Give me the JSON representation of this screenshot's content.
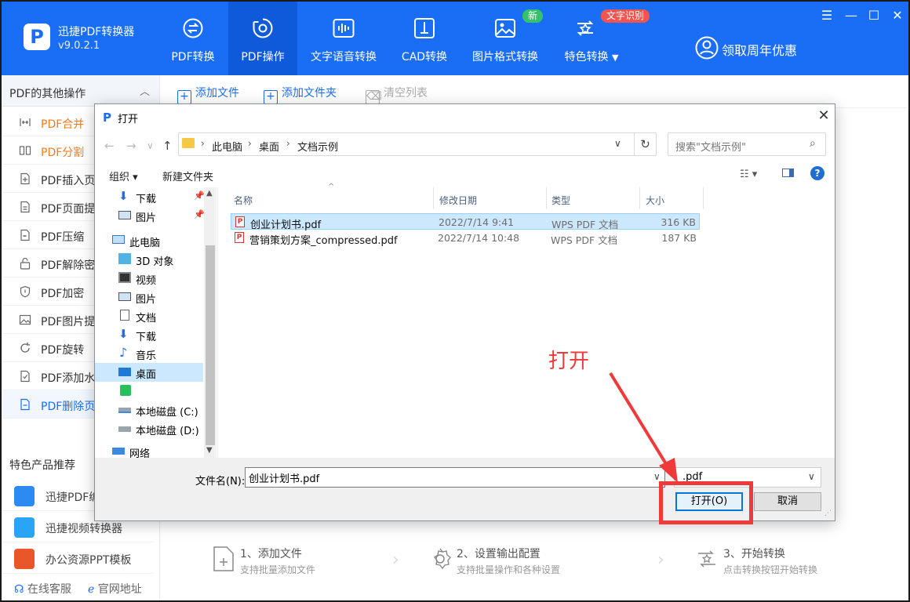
{
  "app": {
    "name": "迅捷PDF转换器",
    "version": "v9.0.2.1",
    "logo_text": "P"
  },
  "nav": [
    {
      "label": "PDF转换",
      "icon": "pdf-convert-icon"
    },
    {
      "label": "PDF操作",
      "icon": "pdf-operate-icon",
      "active": true
    },
    {
      "label": "文字语音转换",
      "icon": "voice-wave-icon"
    },
    {
      "label": "CAD转换",
      "icon": "cad-icon"
    },
    {
      "label": "图片格式转换",
      "icon": "image-icon",
      "badge": "新"
    },
    {
      "label": "特色转换",
      "icon": "special-convert-icon",
      "badge": "文字识别",
      "dropdown": true
    }
  ],
  "promo": {
    "label": "领取周年优惠"
  },
  "window_controls": {
    "menu": "☰",
    "minimize": "—",
    "maximize": "☐",
    "close": "✕"
  },
  "sidebar": {
    "title": "PDF的其他操作",
    "items": [
      {
        "label": "PDF合并",
        "style": "orange"
      },
      {
        "label": "PDF分割",
        "style": "orange"
      },
      {
        "label": "PDF插入页"
      },
      {
        "label": "PDF页面提"
      },
      {
        "label": "PDF压缩"
      },
      {
        "label": "PDF解除密"
      },
      {
        "label": "PDF加密"
      },
      {
        "label": "PDF图片提"
      },
      {
        "label": "PDF旋转"
      },
      {
        "label": "PDF添加水"
      },
      {
        "label": "PDF删除页",
        "style": "blue",
        "selected": true
      }
    ],
    "recommend_title": "特色产品推荐",
    "recommend": [
      {
        "label": "迅捷PDF编",
        "icon_color": "#2b8bf2"
      },
      {
        "label": "迅捷视频转换器",
        "icon_color": "#2aa5f5"
      },
      {
        "label": "办公资源PPT模板",
        "icon_color": "#e8562a"
      }
    ],
    "footer": {
      "service": "在线客服",
      "website": "官网地址"
    }
  },
  "toolbar": {
    "add_file": "添加文件",
    "add_folder": "添加文件夹",
    "clear_list": "清空列表"
  },
  "steps": [
    {
      "title": "1、添加文件",
      "sub": "支持批量添加文件"
    },
    {
      "title": "2、设置输出配置",
      "sub": "支持批量操作和各种设置"
    },
    {
      "title": "3、开始转换",
      "sub": "点击转换按钮开始转换"
    }
  ],
  "dialog": {
    "title": "打开",
    "close": "✕",
    "breadcrumb": [
      "此电脑",
      "桌面",
      "文档示例"
    ],
    "search_placeholder": "搜索\"文档示例\"",
    "organize": "组织 ▾",
    "new_folder": "新建文件夹",
    "tree": [
      {
        "label": "下载",
        "pinned": true,
        "indent": 1
      },
      {
        "label": "图片",
        "pinned": true,
        "indent": 1
      },
      {
        "label": "此电脑",
        "indent": 0
      },
      {
        "label": "3D 对象",
        "indent": 1
      },
      {
        "label": "视频",
        "indent": 1
      },
      {
        "label": "图片",
        "indent": 1
      },
      {
        "label": "文档",
        "indent": 1
      },
      {
        "label": "下载",
        "indent": 1
      },
      {
        "label": "音乐",
        "indent": 1
      },
      {
        "label": "桌面",
        "indent": 1,
        "selected": true
      },
      {
        "label": "",
        "indent": 1
      },
      {
        "label": "本地磁盘 (C:)",
        "indent": 1
      },
      {
        "label": "本地磁盘 (D:)",
        "indent": 1
      },
      {
        "label": "网络",
        "indent": 0
      }
    ],
    "columns": {
      "name": "名称",
      "modified": "修改日期",
      "type": "类型",
      "size": "大小"
    },
    "files": [
      {
        "name": "创业计划书.pdf",
        "modified": "2022/7/14 9:41",
        "type": "WPS PDF 文档",
        "size": "316 KB",
        "selected": true
      },
      {
        "name": "营销策划方案_compressed.pdf",
        "modified": "2022/7/14 10:48",
        "type": "WPS PDF 文档",
        "size": "187 KB"
      }
    ],
    "filename_label": "文件名(N):",
    "filename_value": "创业计划书.pdf",
    "filetype_value": ".pdf",
    "open_button": "打开(O)",
    "cancel_button": "取消"
  },
  "annotation": {
    "text": "打开",
    "color": "#f03a3a"
  },
  "colors": {
    "brand": "#1a6df5",
    "orange": "#f47b20",
    "badge_green": "#35c26a",
    "badge_red": "#f2544f"
  }
}
